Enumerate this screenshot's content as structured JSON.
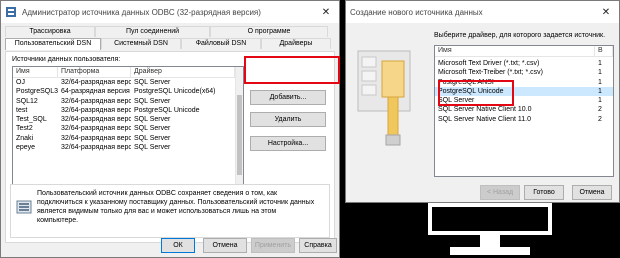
{
  "odbc": {
    "title": "Администратор источника данных ODBC (32-разрядная версия)",
    "tabs_top": [
      "Трассировка",
      "Пул соединений",
      "О программе"
    ],
    "tabs_bottom": [
      "Пользовательский DSN",
      "Системный DSN",
      "Файловый DSN",
      "Драйверы"
    ],
    "list_caption": "Источники данных пользователя:",
    "columns": [
      "Имя",
      "Платформа",
      "Драйвер"
    ],
    "rows": [
      [
        "OJ",
        "32/64-разрядная версия",
        "SQL Server"
      ],
      [
        "PostgreSQL35W",
        "64-разрядная версия",
        "PostgreSQL Unicode(x64)"
      ],
      [
        "SQL12",
        "32/64-разрядная версия",
        "SQL Server"
      ],
      [
        "test",
        "32/64-разрядная версия",
        "PostgreSQL Unicode"
      ],
      [
        "Test_SQL",
        "32/64-разрядная версия",
        "SQL Server"
      ],
      [
        "Test2",
        "32/64-разрядная версия",
        "SQL Server"
      ],
      [
        "Znaki",
        "32/64-разрядная версия",
        "SQL Server"
      ],
      [
        "epeye",
        "32/64-разрядная версия",
        "SQL Server"
      ]
    ],
    "buttons": {
      "add": "Добавить...",
      "remove": "Удалить",
      "configure": "Настройка..."
    },
    "info": "Пользовательский источник данных ODBC сохраняет сведения о том, как подключиться к указанному поставщику данных. Пользовательский источник данных является видимым только для вас и может использоваться лишь на этом компьютере.",
    "footer": {
      "ok": "ОК",
      "cancel": "Отмена",
      "apply": "Применить",
      "help": "Справка"
    }
  },
  "newsrc": {
    "title": "Создание нового источника данных",
    "prompt": "Выберите драйвер, для которого задается источник.",
    "columns": [
      "Имя",
      "В"
    ],
    "drivers": [
      [
        "Microsoft Text Driver (*.txt; *.csv)",
        "1"
      ],
      [
        "Microsoft Text-Treiber (*.txt; *.csv)",
        "1"
      ],
      [
        "PostgreSQL ANSI",
        "1"
      ],
      [
        "PostgreSQL Unicode",
        "1"
      ],
      [
        "SQL Server",
        "1"
      ],
      [
        "SQL Server Native Client 10.0",
        "2"
      ],
      [
        "SQL Server Native Client 11.0",
        "2"
      ]
    ],
    "footer": {
      "back": "< Назад",
      "finish": "Готово",
      "cancel": "Отмена"
    }
  },
  "colors": {
    "highlight": "#e30613",
    "selection": "#cce8ff",
    "accent": "#0078d7"
  }
}
